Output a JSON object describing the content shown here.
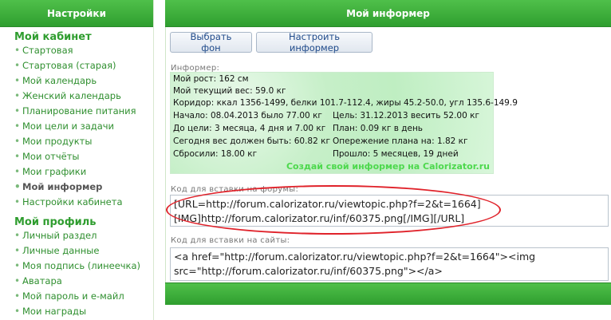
{
  "sidebar": {
    "header": "Настройки",
    "section1_title": "Мой кабинет",
    "section1_items": [
      {
        "label": "Стартовая"
      },
      {
        "label": "Стартовая (старая)"
      },
      {
        "label": "Мой календарь"
      },
      {
        "label": "Женский календарь"
      },
      {
        "label": "Планирование питания"
      },
      {
        "label": "Мои цели и задачи"
      },
      {
        "label": "Мои продукты"
      },
      {
        "label": "Мои отчёты"
      },
      {
        "label": "Мои графики"
      },
      {
        "label": "Мой информер"
      },
      {
        "label": "Настройки кабинета"
      }
    ],
    "section2_title": "Мой профиль",
    "section2_items": [
      {
        "label": "Личный раздел"
      },
      {
        "label": "Личные данные"
      },
      {
        "label": "Моя подпись (линеечка)"
      },
      {
        "label": "Аватара"
      },
      {
        "label": "Мой пароль и е-майл"
      },
      {
        "label": "Мои награды"
      }
    ]
  },
  "main": {
    "title": "Мой информер",
    "buttons": {
      "choose_bg": "Выбрать фон",
      "configure": "Настроить информер"
    },
    "informer_label": "Информер:",
    "informer": {
      "height": "Мой рост: 162 см",
      "weight": "Мой текущий вес: 59.0 кг",
      "corridor": "Коридор: ккал 1356-1499, белки 101.7-112.4, жиры 45.2-50.0, угл 135.6-149.9",
      "start": "Начало: 08.04.2013 было 77.00 кг",
      "goal": "Цель: 31.12.2013 весить 52.00 кг",
      "to_goal": "До цели: 3 месяца, 4 дня и 7.00 кг",
      "plan": "План: 0.09 кг в день",
      "today": "Сегодня вес должен быть: 60.82 кг",
      "ahead": "Опережение плана на: 1.82 кг",
      "lost": "Сбросили: 18.00 кг",
      "passed": "Прошло: 5 месяцев, 19 дней",
      "link": "Создай свой информер на Calorizator.ru"
    },
    "forum_label": "Код для вставки на форумы:",
    "forum_code": {
      "line1": "[URL=http://forum.calorizator.ru/viewtopic.php?f=2&t=1664]",
      "line2": "[IMG]http://forum.calorizator.ru/inf/60375.png[/IMG][/URL]"
    },
    "site_label": "Код для вставки на сайты:",
    "site_code": {
      "line1": "<a href=\"http://forum.calorizator.ru/viewtopic.php?f=2&t=1664\"><img",
      "line2": "src=\"http://forum.calorizator.ru/inf/60375.png\"></a>"
    }
  },
  "colors": {
    "accent_green": "#2f9e2f",
    "link_green": "#2f8f2f",
    "annotation_red": "#e0222a",
    "informer_bg": "#c6efc8"
  }
}
